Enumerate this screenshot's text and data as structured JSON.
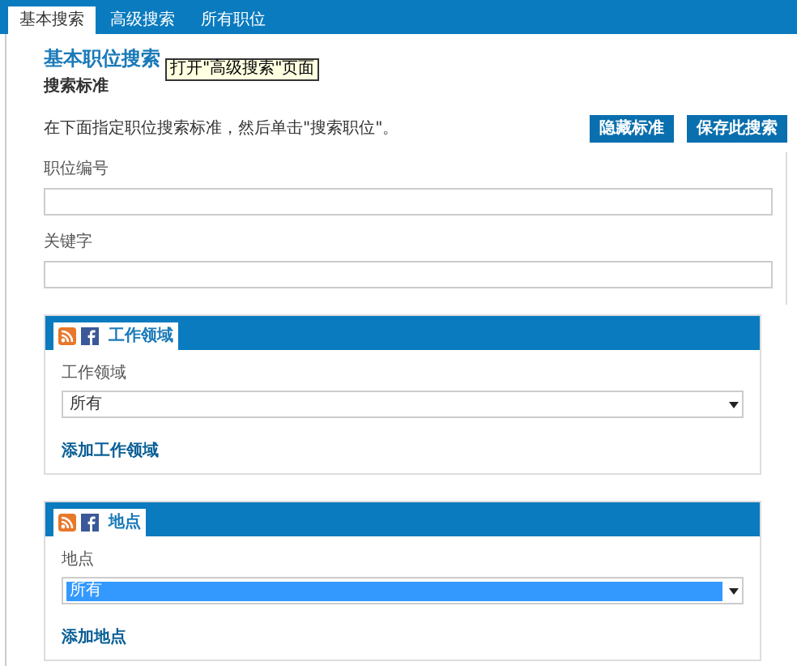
{
  "tabs": [
    {
      "label": "基本搜索",
      "selected": true
    },
    {
      "label": "高级搜索",
      "selected": false
    },
    {
      "label": "所有职位",
      "selected": false
    }
  ],
  "heading": "基本职位搜索",
  "tooltip": "打开\"高级搜索\"页面",
  "subheading": "搜索标准",
  "instructions": "在下面指定职位搜索标准，然后单击\"搜索职位\"。",
  "buttons": [
    "隐藏标准",
    "保存此搜索"
  ],
  "fields": [
    {
      "label": "职位编号"
    },
    {
      "label": "关键字"
    }
  ],
  "panels": [
    {
      "title": "工作领域",
      "field_label": "工作领域",
      "value": "所有",
      "focused": false,
      "link": "添加工作领域"
    },
    {
      "title": "地点",
      "field_label": "地点",
      "value": "所有",
      "focused": true,
      "link": "添加地点"
    }
  ]
}
